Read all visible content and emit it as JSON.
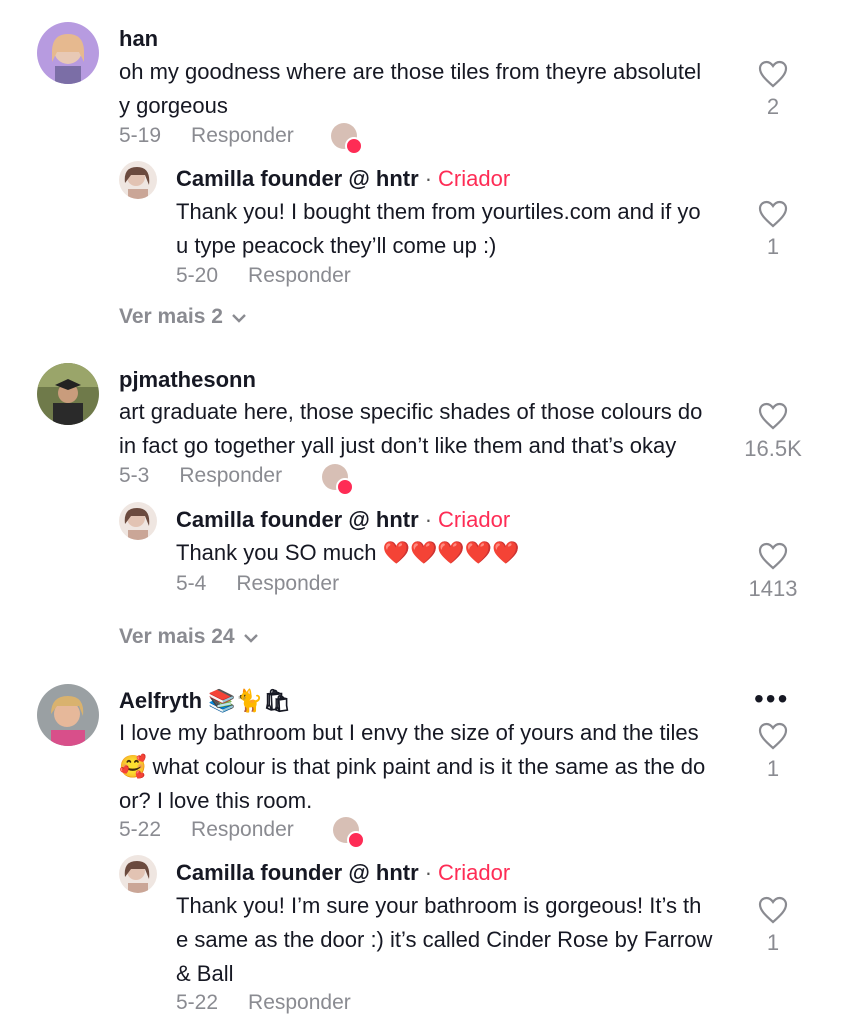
{
  "comments": [
    {
      "username": "han",
      "text": "oh my goodness where are those tiles from theyre absolutel\ny gorgeous",
      "date": "5-19",
      "reply_label": "Responder",
      "likes": "2",
      "reply": {
        "username": "Camilla founder @ hntr",
        "badge": "Criador",
        "text": "Thank you! I bought them from yourtiles.com and if yo\nu type peacock they’ll come up :)",
        "date": "5-20",
        "reply_label": "Responder",
        "likes": "1"
      },
      "view_more": "Ver mais 2"
    },
    {
      "username": "pjmathesonn",
      "text": "art graduate here, those specific shades of those colours do\nin fact go together yall just don’t like them and that’s okay",
      "date": "5-3",
      "reply_label": "Responder",
      "likes": "16.5K",
      "reply": {
        "username": "Camilla founder @ hntr",
        "badge": "Criador",
        "text": "Thank you SO much ❤️❤️❤️❤️❤️",
        "date": "5-4",
        "reply_label": "Responder",
        "likes": "1413"
      },
      "view_more": "Ver mais 24"
    },
    {
      "username": "Aelfryth 📚🐈🛍",
      "text": "I love my bathroom but I envy the size of yours and the tiles\n🥰 what colour is that pink paint and is it the same as the do\nor? I love this room.",
      "date": "5-22",
      "reply_label": "Responder",
      "likes": "1",
      "reply": {
        "username": "Camilla founder @ hntr",
        "badge": "Criador",
        "text": "Thank you! I’m sure your bathroom is gorgeous! It’s th\ne same as the door :) it’s called Cinder Rose by Farrow\n& Ball",
        "date": "5-22",
        "reply_label": "Responder",
        "likes": "1"
      }
    }
  ],
  "more_menu": "•••",
  "dot_separator": "·",
  "colors": {
    "creator": "#fe2c55",
    "muted": "#8a8b91",
    "text": "#161823"
  }
}
